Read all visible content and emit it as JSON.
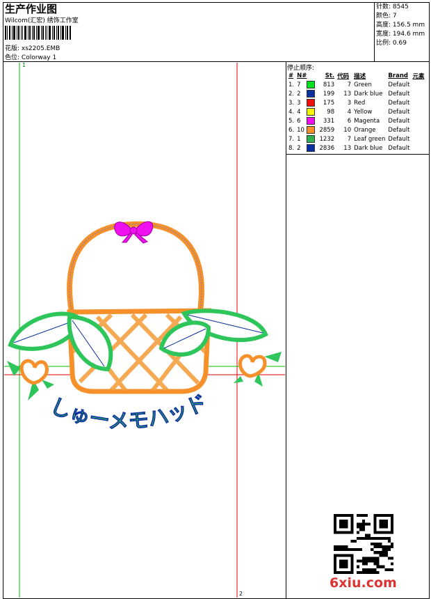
{
  "header": {
    "title": "生产作业图",
    "company": "Wilcom(汇宏) 绣饰工作室",
    "file_label": "花版:",
    "file_name": "xs2205.EMB",
    "color_label": "色位:",
    "colorway": "Colorway 1"
  },
  "stats": {
    "stitches_label": "针数:",
    "stitches": "8545",
    "colors_label": "颜色:",
    "colors": "7",
    "height_label": "高度:",
    "height": "156.5 mm",
    "width_label": "宽度:",
    "width": "194.6 mm",
    "scale_label": "比例:",
    "scale": "0.69"
  },
  "stop_sequence": {
    "title": "停止顺序:",
    "headers": [
      "#",
      "N#",
      "St.",
      "代码",
      "描述",
      "Brand",
      "元素"
    ],
    "rows": [
      {
        "n": "1.",
        "num": "7",
        "color": "#00e020",
        "st": "813",
        "code": "7",
        "desc": "Green",
        "brand": "Default"
      },
      {
        "n": "2.",
        "num": "2",
        "color": "#0a2fa0",
        "st": "199",
        "code": "13",
        "desc": "Dark blue",
        "brand": "Default"
      },
      {
        "n": "3.",
        "num": "3",
        "color": "#ee1010",
        "st": "175",
        "code": "3",
        "desc": "Red",
        "brand": "Default"
      },
      {
        "n": "4.",
        "num": "4",
        "color": "#f5f500",
        "st": "98",
        "code": "4",
        "desc": "Yellow",
        "brand": "Default"
      },
      {
        "n": "5.",
        "num": "6",
        "color": "#ee10ee",
        "st": "331",
        "code": "6",
        "desc": "Magenta",
        "brand": "Default"
      },
      {
        "n": "6.",
        "num": "10",
        "color": "#f5902a",
        "st": "2859",
        "code": "10",
        "desc": "Orange",
        "brand": "Default"
      },
      {
        "n": "7.",
        "num": "1",
        "color": "#30b050",
        "st": "1232",
        "code": "7",
        "desc": "Leaf green",
        "brand": "Default"
      },
      {
        "n": "8.",
        "num": "2",
        "color": "#0a2fa0",
        "st": "2836",
        "code": "13",
        "desc": "Dark blue",
        "brand": "Default"
      }
    ]
  },
  "markers": {
    "start": "1",
    "end": "2"
  },
  "design_text": "しゅーメモハッド",
  "watermark": "6xiu.com",
  "colors": {
    "orange": "#f5902a",
    "green": "#2ec65a",
    "leaf": "#3bbd5a",
    "blue": "#0a2fa0",
    "magenta": "#ee10ee",
    "guide_red": "#e00000",
    "guide_green": "#00c000"
  }
}
